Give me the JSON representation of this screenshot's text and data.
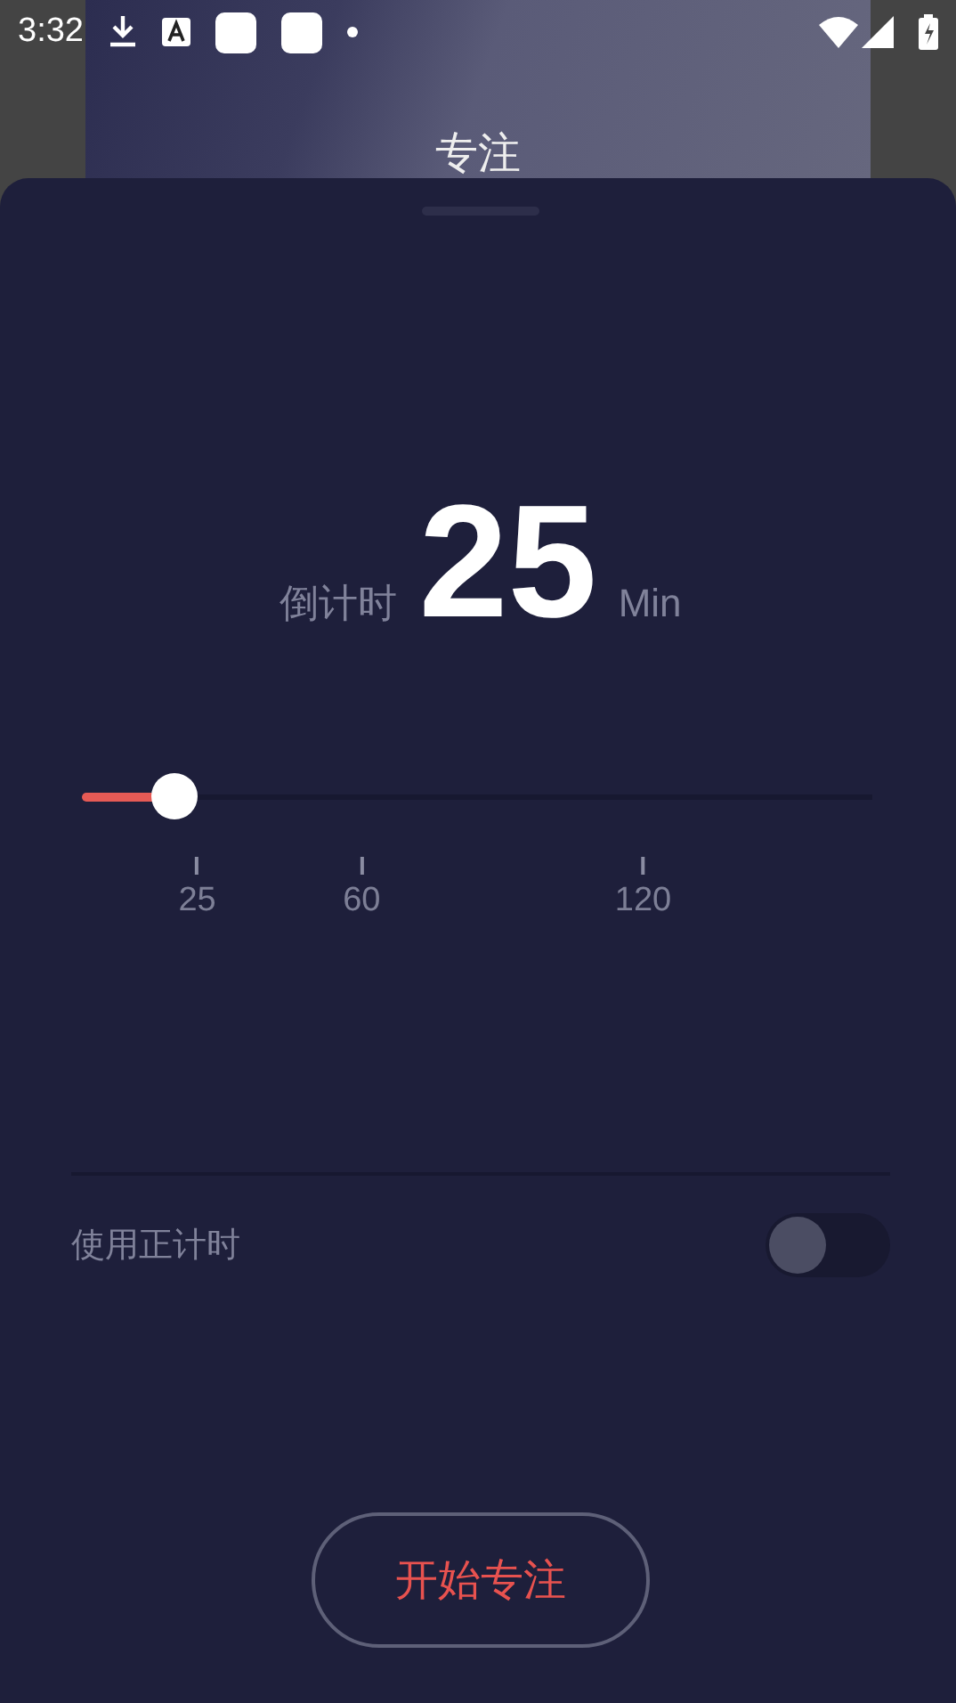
{
  "status_bar": {
    "time": "3:32"
  },
  "header": {
    "title": "专注"
  },
  "timer": {
    "label": "倒计时",
    "value": "25",
    "unit": "Min"
  },
  "slider": {
    "level": 0.117,
    "ticks": [
      "25",
      "60",
      "120"
    ]
  },
  "count_up": {
    "label": "使用正计时",
    "on": false
  },
  "start_button": {
    "label": "开始专注"
  }
}
